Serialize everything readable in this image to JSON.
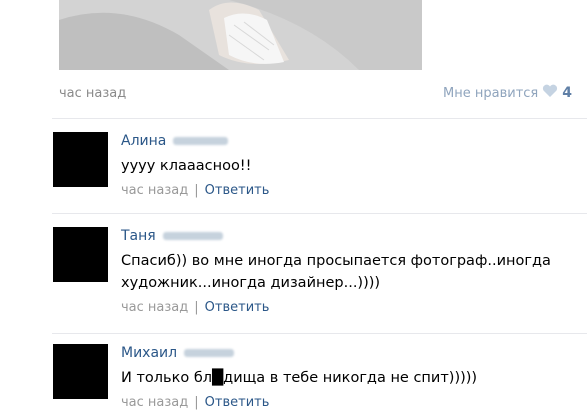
{
  "post": {
    "time": "час назад",
    "like_label": "Мне нравится",
    "like_count": "4"
  },
  "comments": [
    {
      "author": "Алина",
      "text": "уууу клааасноо!!",
      "time": "час назад",
      "sep": "|",
      "reply": "Ответить"
    },
    {
      "author": "Таня",
      "text": "Спасиб)) во мне иногда просыпается фотограф..иногда художник...иногда дизайнер...))))",
      "time": "час назад",
      "sep": "|",
      "reply": "Ответить"
    },
    {
      "author": "Михаил",
      "text": "И только бл█дища в тебе никогда не спит)))))",
      "time": "час назад",
      "sep": "|",
      "reply": "Ответить"
    }
  ]
}
